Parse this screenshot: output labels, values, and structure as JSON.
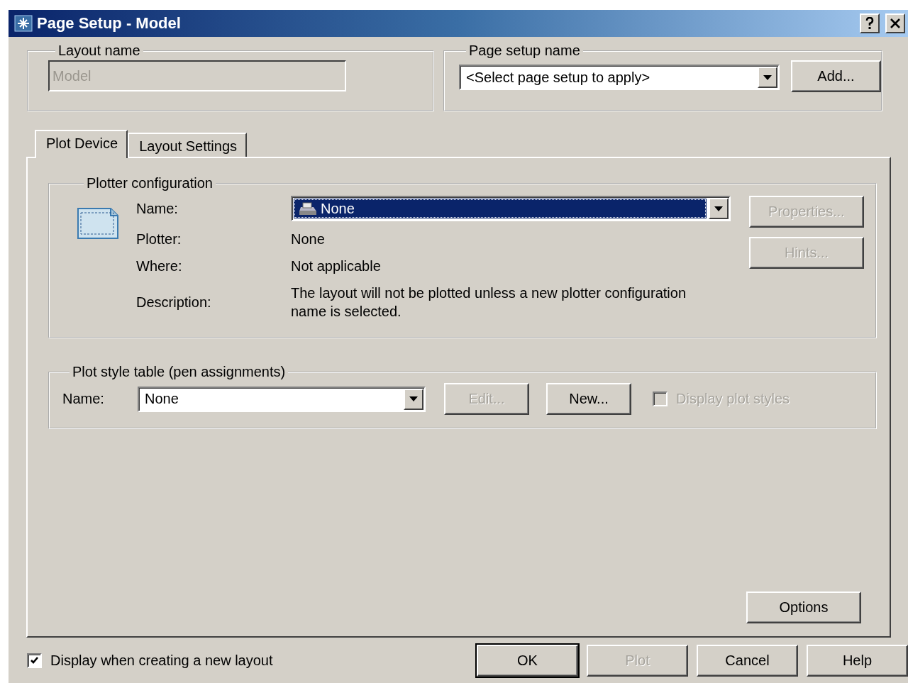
{
  "window": {
    "title": "Page Setup - Model"
  },
  "layout_name": {
    "label": "Layout name",
    "value": "Model",
    "disabled": true
  },
  "page_setup_name": {
    "label": "Page setup name",
    "value": "<Select page setup to apply>",
    "button": "Add..."
  },
  "tabs": [
    {
      "label": "Plot Device",
      "selected": true
    },
    {
      "label": "Layout Settings",
      "selected": false
    }
  ],
  "plotter_configuration": {
    "title": "Plotter configuration",
    "fields": [
      {
        "label": "Name:",
        "kind": "combo",
        "value": "None",
        "selected": true
      },
      {
        "label": "Plotter:",
        "kind": "text",
        "value": "None"
      },
      {
        "label": "Where:",
        "kind": "text",
        "value": "Not applicable"
      },
      {
        "label": "Description:",
        "kind": "text",
        "value": "The layout will not be plotted unless a new plotter configuration name is selected."
      }
    ],
    "buttons": [
      {
        "label": "Properties...",
        "disabled": true
      },
      {
        "label": "Hints...",
        "disabled": true
      }
    ]
  },
  "plot_style_table": {
    "title": "Plot style table (pen assignments)",
    "name_label": "Name:",
    "value": "None",
    "buttons": [
      {
        "label": "Edit...",
        "disabled": true
      },
      {
        "label": "New...",
        "disabled": false
      }
    ],
    "checkbox": {
      "label": "Display plot styles",
      "checked": false,
      "disabled": true
    }
  },
  "options_button": {
    "label": "Options",
    "disabled": false
  },
  "footer": {
    "checkbox": {
      "label": "Display when creating a new layout",
      "checked": true,
      "disabled": false
    },
    "buttons": [
      {
        "label": "OK",
        "disabled": false,
        "default": true
      },
      {
        "label": "Plot",
        "disabled": true,
        "default": false
      },
      {
        "label": "Cancel",
        "disabled": false,
        "default": false
      },
      {
        "label": "Help",
        "disabled": false,
        "default": false
      }
    ]
  }
}
